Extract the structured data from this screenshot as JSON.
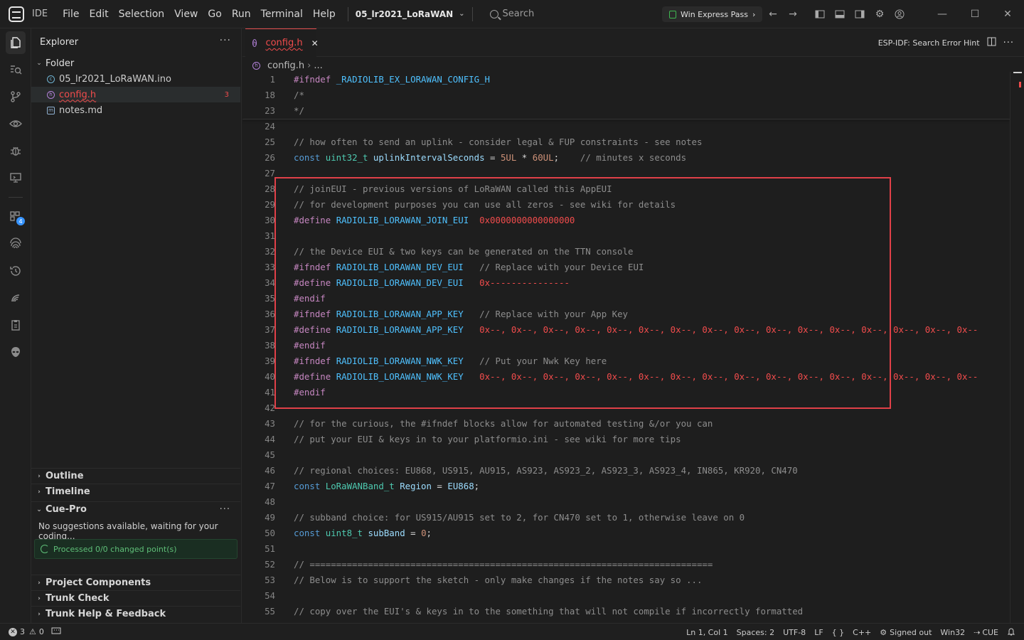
{
  "titlebar": {
    "ide_label": "IDE",
    "menu": [
      "File",
      "Edit",
      "Selection",
      "View",
      "Go",
      "Run",
      "Terminal",
      "Help"
    ],
    "project": "05_lr2021_LoRaWAN",
    "search_placeholder": "Search",
    "pass_label": "Win Express Pass"
  },
  "sidebar": {
    "title": "Explorer",
    "folder_label": "Folder",
    "files": [
      {
        "name": "05_lr2021_LoRaWAN.ino"
      },
      {
        "name": "config.h",
        "errors": "3"
      },
      {
        "name": "notes.md"
      }
    ],
    "sections": {
      "outline": "Outline",
      "timeline": "Timeline",
      "cue_pro": "Cue-Pro",
      "project_components": "Project Components",
      "trunk_check": "Trunk Check",
      "trunk_help": "Trunk Help & Feedback"
    },
    "cue_message": "No suggestions available, waiting for your coding...",
    "cue_status": "Processed 0/0 changed point(s)"
  },
  "editor": {
    "tab_label": "config.h",
    "right_action": "ESP-IDF: Search Error Hint",
    "breadcrumb": {
      "file": "config.h",
      "rest": "..."
    },
    "lines": [
      {
        "n": "1",
        "t": [
          [
            "pp",
            "#ifndef "
          ],
          [
            "mc",
            "_RADIOLIB_EX_LORAWAN_CONFIG_H"
          ]
        ]
      },
      {
        "n": "18",
        "t": [
          [
            "cm",
            "/*"
          ]
        ]
      },
      {
        "n": "23",
        "t": [
          [
            "cm",
            "*/"
          ]
        ]
      },
      {
        "n": "24",
        "t": []
      },
      {
        "n": "25",
        "t": [
          [
            "cm",
            "// how often to send an uplink - consider legal & FUP constraints - see notes"
          ]
        ]
      },
      {
        "n": "26",
        "t": [
          [
            "kw",
            "const "
          ],
          [
            "ty",
            "uint32_t "
          ],
          [
            "id",
            "uplinkIntervalSeconds"
          ],
          [
            "pl",
            " = "
          ],
          [
            "num",
            "5UL"
          ],
          [
            "pl",
            " * "
          ],
          [
            "num",
            "60UL"
          ],
          [
            "pl",
            ";    "
          ],
          [
            "cm",
            "// minutes x seconds"
          ]
        ]
      },
      {
        "n": "27",
        "t": []
      },
      {
        "n": "28",
        "t": [
          [
            "cm",
            "// joinEUI - previous versions of LoRaWAN called this AppEUI"
          ]
        ]
      },
      {
        "n": "29",
        "t": [
          [
            "cm",
            "// for development purposes you can use all zeros - see wiki for details"
          ]
        ]
      },
      {
        "n": "30",
        "t": [
          [
            "pp",
            "#define "
          ],
          [
            "mc",
            "RADIOLIB_LORAWAN_JOIN_EUI"
          ],
          [
            "pl",
            "  "
          ],
          [
            "hex",
            "0x0000000000000000"
          ]
        ]
      },
      {
        "n": "31",
        "t": []
      },
      {
        "n": "32",
        "t": [
          [
            "cm",
            "// the Device EUI & two keys can be generated on the TTN console"
          ]
        ]
      },
      {
        "n": "33",
        "t": [
          [
            "pp",
            "#ifndef "
          ],
          [
            "mc",
            "RADIOLIB_LORAWAN_DEV_EUI"
          ],
          [
            "pl",
            "   "
          ],
          [
            "cm",
            "// Replace with your Device EUI"
          ]
        ]
      },
      {
        "n": "34",
        "t": [
          [
            "pp",
            "#define "
          ],
          [
            "mc",
            "RADIOLIB_LORAWAN_DEV_EUI"
          ],
          [
            "pl",
            "   "
          ],
          [
            "hex",
            "0x---------------"
          ]
        ]
      },
      {
        "n": "35",
        "t": [
          [
            "pp",
            "#endif"
          ]
        ]
      },
      {
        "n": "36",
        "t": [
          [
            "pp",
            "#ifndef "
          ],
          [
            "mc",
            "RADIOLIB_LORAWAN_APP_KEY"
          ],
          [
            "pl",
            "   "
          ],
          [
            "cm",
            "// Replace with your App Key"
          ]
        ]
      },
      {
        "n": "37",
        "t": [
          [
            "pp",
            "#define "
          ],
          [
            "mc",
            "RADIOLIB_LORAWAN_APP_KEY"
          ],
          [
            "pl",
            "   "
          ],
          [
            "hex",
            "0x--, 0x--, 0x--, 0x--, 0x--, 0x--, 0x--, 0x--, 0x--, 0x--, 0x--, 0x--, 0x--, 0x--, 0x--, 0x--"
          ]
        ]
      },
      {
        "n": "38",
        "t": [
          [
            "pp",
            "#endif"
          ]
        ]
      },
      {
        "n": "39",
        "t": [
          [
            "pp",
            "#ifndef "
          ],
          [
            "mc",
            "RADIOLIB_LORAWAN_NWK_KEY"
          ],
          [
            "pl",
            "   "
          ],
          [
            "cm",
            "// Put your Nwk Key here"
          ]
        ]
      },
      {
        "n": "40",
        "t": [
          [
            "pp",
            "#define "
          ],
          [
            "mc",
            "RADIOLIB_LORAWAN_NWK_KEY"
          ],
          [
            "pl",
            "   "
          ],
          [
            "hex",
            "0x--, 0x--, 0x--, 0x--, 0x--, 0x--, 0x--, 0x--, 0x--, 0x--, 0x--, 0x--, 0x--, 0x--, 0x--, 0x--"
          ]
        ]
      },
      {
        "n": "41",
        "t": [
          [
            "pp",
            "#endif"
          ]
        ]
      },
      {
        "n": "42",
        "t": []
      },
      {
        "n": "43",
        "t": [
          [
            "cm",
            "// for the curious, the #ifndef blocks allow for automated testing &/or you can"
          ]
        ]
      },
      {
        "n": "44",
        "t": [
          [
            "cm",
            "// put your EUI & keys in to your platformio.ini - see wiki for more tips"
          ]
        ]
      },
      {
        "n": "45",
        "t": []
      },
      {
        "n": "46",
        "t": [
          [
            "cm",
            "// regional choices: EU868, US915, AU915, AS923, AS923_2, AS923_3, AS923_4, IN865, KR920, CN470"
          ]
        ]
      },
      {
        "n": "47",
        "t": [
          [
            "kw",
            "const "
          ],
          [
            "ty",
            "LoRaWANBand_t "
          ],
          [
            "id",
            "Region"
          ],
          [
            "pl",
            " = "
          ],
          [
            "id",
            "EU868"
          ],
          [
            "pl",
            ";"
          ]
        ]
      },
      {
        "n": "48",
        "t": []
      },
      {
        "n": "49",
        "t": [
          [
            "cm",
            "// subband choice: for US915/AU915 set to 2, for CN470 set to 1, otherwise leave on 0"
          ]
        ]
      },
      {
        "n": "50",
        "t": [
          [
            "kw",
            "const "
          ],
          [
            "ty",
            "uint8_t "
          ],
          [
            "id",
            "subBand"
          ],
          [
            "pl",
            " = "
          ],
          [
            "num",
            "0"
          ],
          [
            "pl",
            ";"
          ]
        ]
      },
      {
        "n": "51",
        "t": []
      },
      {
        "n": "52",
        "t": [
          [
            "cm",
            "// ============================================================================"
          ]
        ]
      },
      {
        "n": "53",
        "t": [
          [
            "cm",
            "// Below is to support the sketch - only make changes if the notes say so ..."
          ]
        ]
      },
      {
        "n": "54",
        "t": []
      },
      {
        "n": "55",
        "t": [
          [
            "cm",
            "// copy over the EUI's & keys in to the something that will not compile if incorrectly formatted"
          ]
        ]
      }
    ]
  },
  "statusbar": {
    "errors": "3",
    "warnings": "0",
    "position": "Ln 1, Col 1",
    "spaces": "Spaces: 2",
    "encoding": "UTF-8",
    "eol": "LF",
    "braces": "{ }",
    "language": "C++",
    "account": "Signed out",
    "platform": "Win32",
    "cue": "CUE"
  }
}
